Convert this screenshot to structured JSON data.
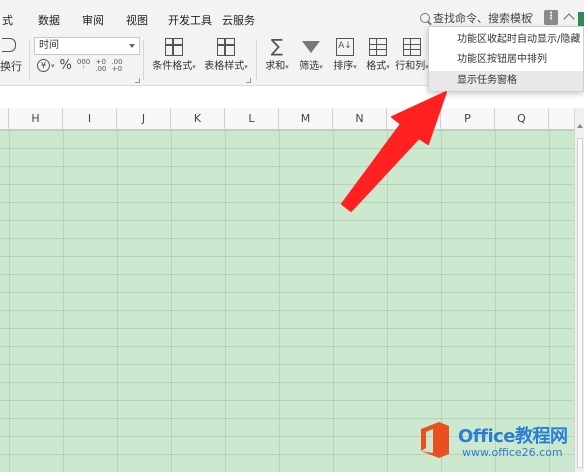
{
  "menubar": {
    "tabs": [
      "式",
      "数据",
      "审阅",
      "视图",
      "开发工具",
      "云服务"
    ],
    "search_label": "查找命令、搜索模板",
    "help_glyph": "?",
    "more_glyph": "⋮"
  },
  "ribbon": {
    "wrap_label": "换行",
    "number_format": "时间",
    "currency_glyph": "¥",
    "percent_glyph": "%",
    "thousands_glyph": "000",
    "dec_increase": [
      "+0",
      ".00"
    ],
    "dec_decrease": [
      ".00",
      "+0"
    ],
    "buttons": [
      {
        "name": "conditional-format",
        "label": "条件格式"
      },
      {
        "name": "table-style",
        "label": "表格样式"
      },
      {
        "name": "sum",
        "label": "求和"
      },
      {
        "name": "filter",
        "label": "筛选"
      },
      {
        "name": "sort",
        "label": "排序"
      },
      {
        "name": "format",
        "label": "格式"
      },
      {
        "name": "row-col",
        "label": "行和列"
      }
    ]
  },
  "dropdown": {
    "options": [
      {
        "label": "功能区收起时自动显示/隐藏",
        "selected": false
      },
      {
        "label": "功能区按钮居中排列",
        "selected": false
      },
      {
        "label": "显示任务窗格",
        "selected": true
      }
    ]
  },
  "sheet": {
    "columns": [
      "H",
      "I",
      "J",
      "K",
      "L",
      "M",
      "N",
      "O",
      "P",
      "Q"
    ],
    "grid_color": "#cce8cf"
  },
  "annotation": {
    "color": "#ff2020"
  },
  "watermark": {
    "title": "Office教程网",
    "url": "www.office26.com",
    "brand_color": "#2a7fd4",
    "logo_color": "#e8501f"
  }
}
